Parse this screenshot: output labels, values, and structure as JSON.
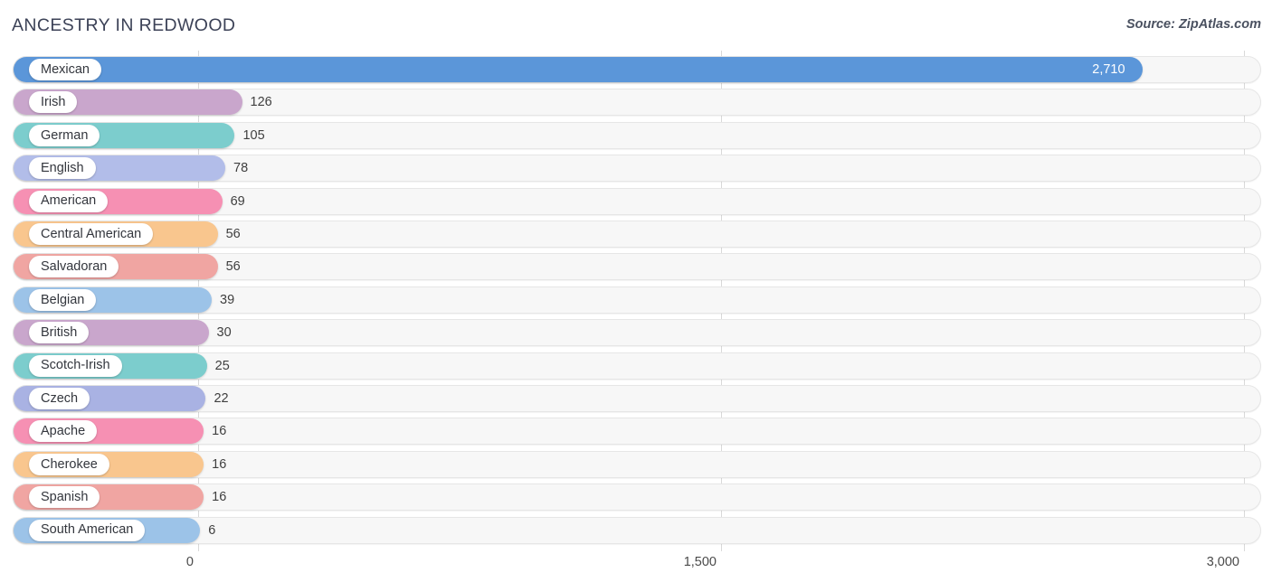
{
  "header": {
    "title": "ANCESTRY IN REDWOOD",
    "source": "Source: ZipAtlas.com"
  },
  "axis": {
    "ticks": [
      {
        "label": "0",
        "value": 0
      },
      {
        "label": "1,500",
        "value": 1500
      },
      {
        "label": "3,000",
        "value": 3000
      }
    ],
    "min": 0,
    "max": 3000
  },
  "chart_data": {
    "type": "bar",
    "orientation": "horizontal",
    "title": "ANCESTRY IN REDWOOD",
    "subtitle": "Source: ZipAtlas.com",
    "xlabel": "",
    "ylabel": "",
    "xlim": [
      0,
      3000
    ],
    "xticks": [
      0,
      1500,
      3000
    ],
    "xticklabels": [
      "0",
      "1,500",
      "3,000"
    ],
    "grid": true,
    "legend": "none",
    "categories": [
      "Mexican",
      "Irish",
      "German",
      "English",
      "American",
      "Central American",
      "Salvadoran",
      "Belgian",
      "British",
      "Scotch-Irish",
      "Czech",
      "Apache",
      "Cherokee",
      "Spanish",
      "South American"
    ],
    "values": [
      2710,
      126,
      105,
      78,
      69,
      56,
      56,
      39,
      30,
      25,
      22,
      16,
      16,
      16,
      6
    ],
    "value_labels": [
      "2,710",
      "126",
      "105",
      "78",
      "69",
      "56",
      "56",
      "39",
      "30",
      "25",
      "22",
      "16",
      "16",
      "16",
      "6"
    ],
    "colors": [
      "#5b96d9",
      "#c9a6cc",
      "#7ccdcd",
      "#b2bde9",
      "#f690b3",
      "#f9c68e",
      "#f0a5a2",
      "#9cc3e8",
      "#c9a6cc",
      "#7ccdcd",
      "#a9b2e3",
      "#f690b3",
      "#f9c68e",
      "#f0a5a2",
      "#9cc3e8"
    ]
  },
  "rows": [
    {
      "label": "Mexican",
      "value": 2710,
      "value_label": "2,710",
      "color": "#5b96d9",
      "label_inside": true
    },
    {
      "label": "Irish",
      "value": 126,
      "value_label": "126",
      "color": "#c9a6cc",
      "label_inside": false
    },
    {
      "label": "German",
      "value": 105,
      "value_label": "105",
      "color": "#7ccdcd",
      "label_inside": false
    },
    {
      "label": "English",
      "value": 78,
      "value_label": "78",
      "color": "#b2bde9",
      "label_inside": false
    },
    {
      "label": "American",
      "value": 69,
      "value_label": "69",
      "color": "#f690b3",
      "label_inside": false
    },
    {
      "label": "Central American",
      "value": 56,
      "value_label": "56",
      "color": "#f9c68e",
      "label_inside": false
    },
    {
      "label": "Salvadoran",
      "value": 56,
      "value_label": "56",
      "color": "#f0a5a2",
      "label_inside": false
    },
    {
      "label": "Belgian",
      "value": 39,
      "value_label": "39",
      "color": "#9cc3e8",
      "label_inside": false
    },
    {
      "label": "British",
      "value": 30,
      "value_label": "30",
      "color": "#c9a6cc",
      "label_inside": false
    },
    {
      "label": "Scotch-Irish",
      "value": 25,
      "value_label": "25",
      "color": "#7ccdcd",
      "label_inside": false
    },
    {
      "label": "Czech",
      "value": 22,
      "value_label": "22",
      "color": "#a9b2e3",
      "label_inside": false
    },
    {
      "label": "Apache",
      "value": 16,
      "value_label": "16",
      "color": "#f690b3",
      "label_inside": false
    },
    {
      "label": "Cherokee",
      "value": 16,
      "value_label": "16",
      "color": "#f9c68e",
      "label_inside": false
    },
    {
      "label": "Spanish",
      "value": 16,
      "value_label": "16",
      "color": "#f0a5a2",
      "label_inside": false
    },
    {
      "label": "South American",
      "value": 6,
      "value_label": "6",
      "color": "#9cc3e8",
      "label_inside": false
    }
  ]
}
